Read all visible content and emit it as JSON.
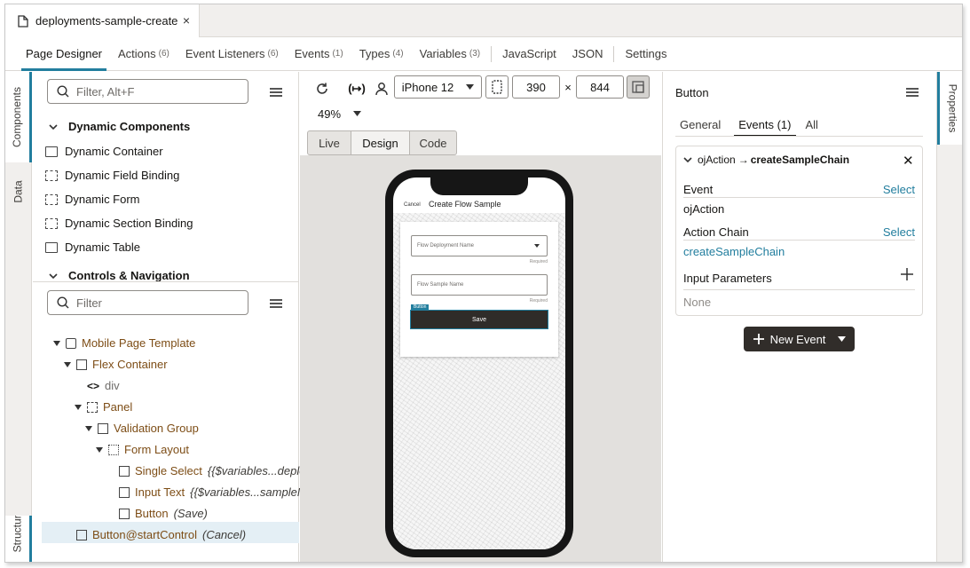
{
  "file_tab": {
    "title": "deployments-sample-create",
    "close": "×"
  },
  "nav": {
    "tabs": [
      {
        "label": "Page Designer",
        "count": ""
      },
      {
        "label": "Actions",
        "count": "(6)"
      },
      {
        "label": "Event Listeners",
        "count": "(6)"
      },
      {
        "label": "Events",
        "count": "(1)"
      },
      {
        "label": "Types",
        "count": "(4)"
      },
      {
        "label": "Variables",
        "count": "(3)"
      },
      {
        "label": "JavaScript",
        "count": ""
      },
      {
        "label": "JSON",
        "count": ""
      },
      {
        "label": "Settings",
        "count": ""
      }
    ]
  },
  "left_rail": {
    "components": "Components",
    "data": "Data",
    "structure": "Structure"
  },
  "components": {
    "filter_placeholder": "Filter, Alt+F",
    "section1": "Dynamic Components",
    "items": [
      "Dynamic Container",
      "Dynamic Field Binding",
      "Dynamic Form",
      "Dynamic Section Binding",
      "Dynamic Table"
    ],
    "section2": "Controls & Navigation"
  },
  "structure": {
    "filter_placeholder": "Filter",
    "nodes": [
      {
        "label": "Mobile Page Template",
        "detail": ""
      },
      {
        "label": "Flex Container",
        "detail": ""
      },
      {
        "label": "div",
        "detail": ""
      },
      {
        "label": "Panel",
        "detail": ""
      },
      {
        "label": "Validation Group",
        "detail": ""
      },
      {
        "label": "Form Layout",
        "detail": ""
      },
      {
        "label": "Single Select",
        "detail": "{{$variables...deploy"
      },
      {
        "label": "Input Text",
        "detail": "{{$variables...sampleN"
      },
      {
        "label": "Button",
        "detail": "(Save)"
      },
      {
        "label": "Button",
        "event": "@startControl",
        "detail": "(Cancel)"
      }
    ]
  },
  "toolbar": {
    "device": "iPhone 12",
    "width": "390",
    "height": "844",
    "times": "×",
    "zoom": "49%",
    "modes": [
      "Live",
      "Design",
      "Code"
    ]
  },
  "phone": {
    "cancel": "Cancel",
    "title": "Create Flow Sample",
    "field1_placeholder": "Flow Deployment Name",
    "field2_placeholder": "Flow Sample Name",
    "required": "Required",
    "button_tag": "Button",
    "save": "Save"
  },
  "properties": {
    "rail_label": "Properties",
    "title": "Button",
    "tabs": [
      "General",
      "Events (1)",
      "All"
    ],
    "event_header_action": "ojAction",
    "event_header_arrow": "→",
    "event_header_chain": "createSampleChain",
    "event_label": "Event",
    "event_value": "ojAction",
    "select": "Select",
    "action_chain_label": "Action Chain",
    "action_chain_value": "createSampleChain",
    "input_params_label": "Input Parameters",
    "input_params_value": "None",
    "new_event": "New Event"
  },
  "colors": {
    "accent": "#227e9e",
    "tree_label": "#7d4d16",
    "dark_button": "#312d2a"
  }
}
